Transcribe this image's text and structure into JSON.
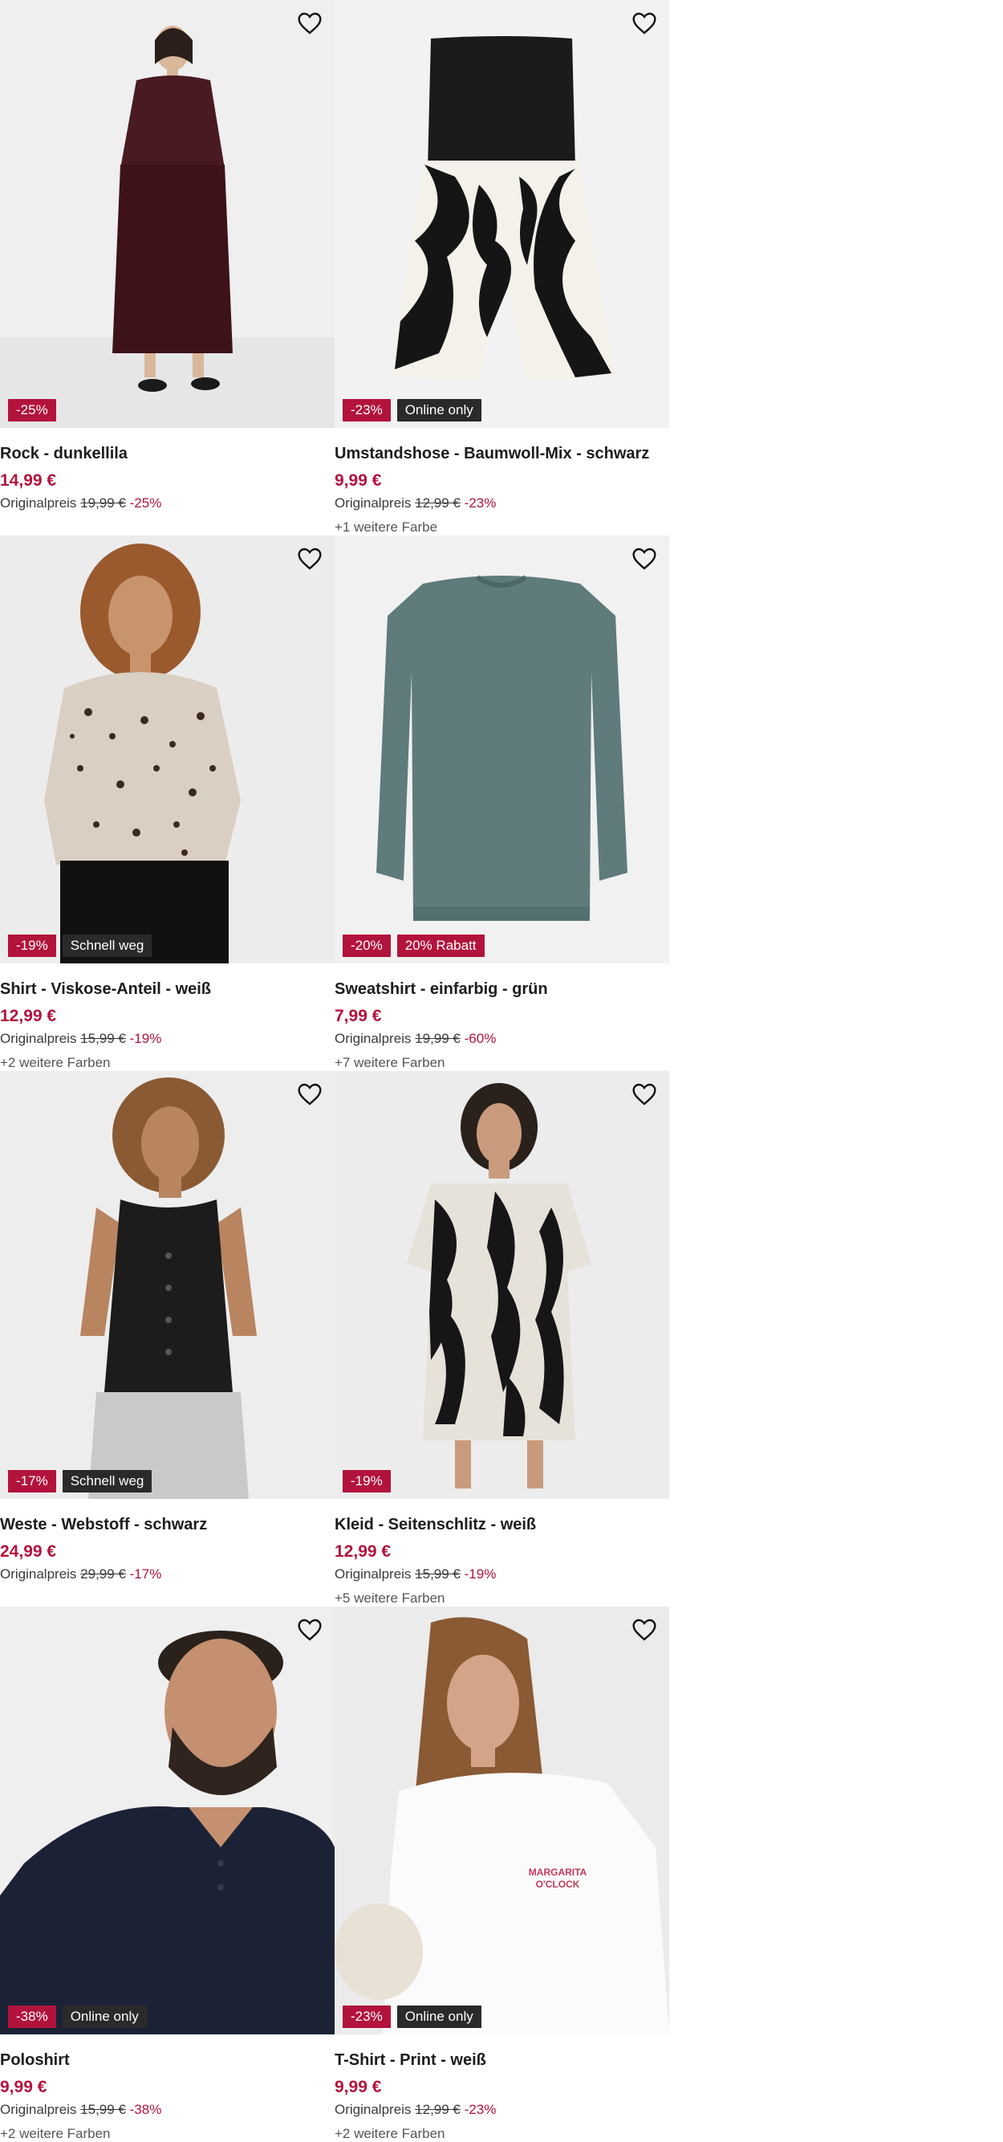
{
  "colors": {
    "sale": "#b2133c",
    "dark_badge": "#2a2a2a",
    "price": "#b2133c"
  },
  "products": [
    {
      "name": "Rock - dunkellila",
      "price": "14,99 €",
      "orig_label": "Originalpreis",
      "orig_price": "19,99 €",
      "pct": "-25%",
      "more": "",
      "badges": [
        "-25%"
      ]
    },
    {
      "name": "Umstandshose - Baumwoll-Mix - schwarz",
      "price": "9,99 €",
      "orig_label": "Originalpreis",
      "orig_price": "12,99 €",
      "pct": "-23%",
      "more": "+1 weitere Farbe",
      "badges": [
        "-23%",
        "Online only"
      ]
    },
    {
      "name": "Shirt - Viskose-Anteil - weiß",
      "price": "12,99 €",
      "orig_label": "Originalpreis",
      "orig_price": "15,99 €",
      "pct": "-19%",
      "more": "+2 weitere Farben",
      "badges": [
        "-19%",
        "Schnell weg"
      ]
    },
    {
      "name": "Sweatshirt - einfarbig - grün",
      "price": "7,99 €",
      "orig_label": "Originalpreis",
      "orig_price": "19,99 €",
      "pct": "-60%",
      "more": "+7 weitere Farben",
      "badges": [
        "-20%",
        "20% Rabatt"
      ]
    },
    {
      "name": "Weste - Webstoff - schwarz",
      "price": "24,99 €",
      "orig_label": "Originalpreis",
      "orig_price": "29,99 €",
      "pct": "-17%",
      "more": "",
      "badges": [
        "-17%",
        "Schnell weg"
      ]
    },
    {
      "name": "Kleid - Seitenschlitz - weiß",
      "price": "12,99 €",
      "orig_label": "Originalpreis",
      "orig_price": "15,99 €",
      "pct": "-19%",
      "more": "+5 weitere Farben",
      "badges": [
        "-19%"
      ]
    },
    {
      "name": "Poloshirt",
      "price": "9,99 €",
      "orig_label": "Originalpreis",
      "orig_price": "15,99 €",
      "pct": "-38%",
      "more": "+2 weitere Farben",
      "badges": [
        "-38%",
        "Online only"
      ]
    },
    {
      "name": "T-Shirt - Print - weiß",
      "price": "9,99 €",
      "orig_label": "Originalpreis",
      "orig_price": "12,99 €",
      "pct": "-23%",
      "more": "+2 weitere Farben",
      "badges": [
        "-23%",
        "Online only"
      ]
    }
  ],
  "print_text": [
    "MARGARITA",
    "O'CLOCK"
  ]
}
